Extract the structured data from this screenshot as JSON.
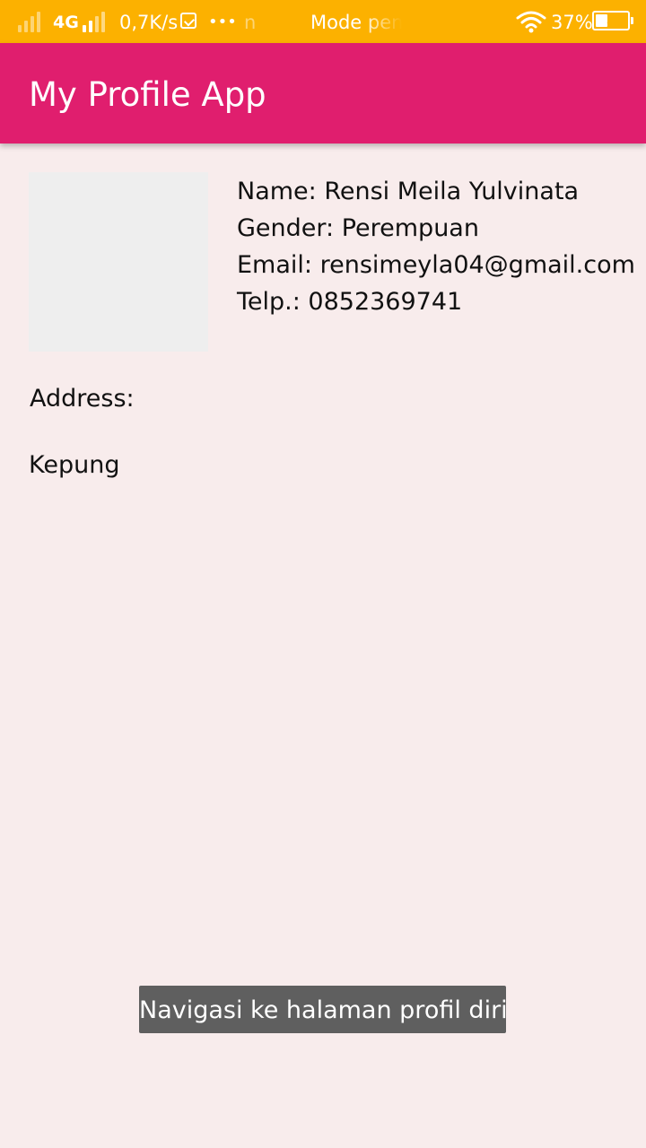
{
  "status_bar": {
    "network_type": "4G",
    "speed": "0,7K/s",
    "more": "•••",
    "notification_fragment": "n",
    "mode_text": "Mode pen",
    "battery_percent": "37%",
    "battery_level": 0.37,
    "background_color": "#fcb100"
  },
  "app_bar": {
    "title": "My Profile App",
    "background_color": "#e01e6e"
  },
  "profile": {
    "name_line": "Name: Rensi Meila Yulvinata",
    "gender_line": "Gender: Perempuan",
    "email_line": "Email: rensimeyla04@gmail.com",
    "phone_line": "Telp.: 0852369741",
    "address_label": "Address:",
    "address_value": "Kepung"
  },
  "toast": {
    "message": "Navigasi ke halaman profil diri"
  }
}
